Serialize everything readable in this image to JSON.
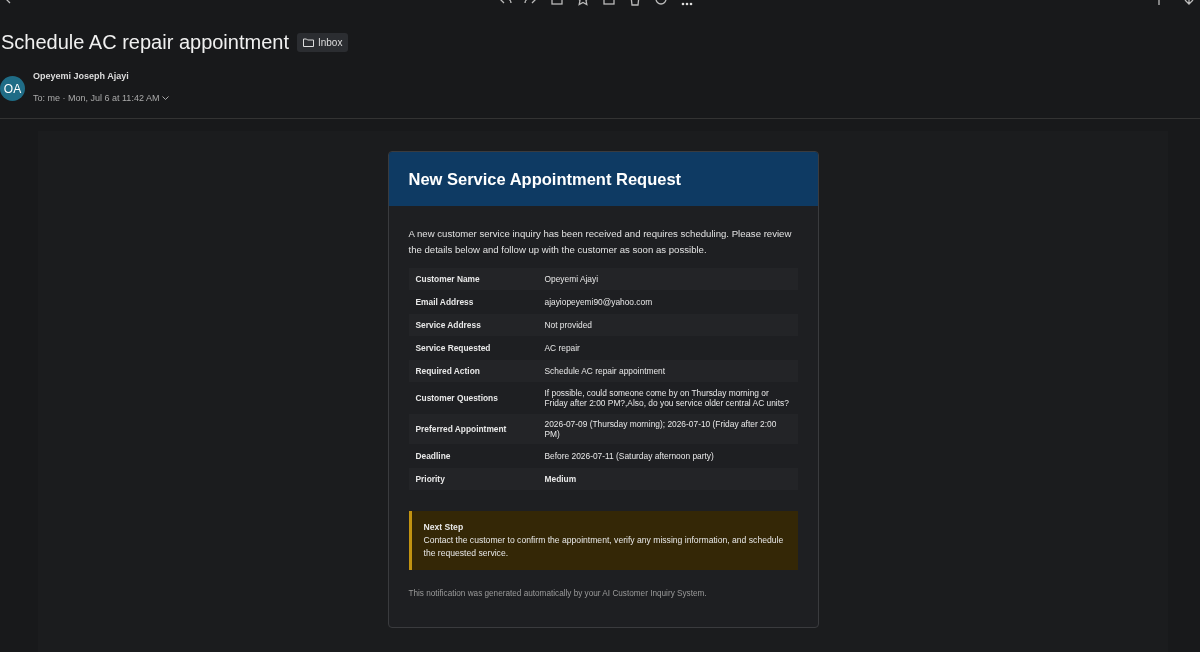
{
  "message": {
    "subject": "Schedule AC repair appointment",
    "folder": "Inbox",
    "sender": {
      "initials": "OA",
      "name": "Opeyemi Joseph Ajayi",
      "recipient_line": "To: me · Mon, Jul 6 at 11:42 AM"
    }
  },
  "card": {
    "heading": "New Service Appointment Request",
    "intro": "A new customer service inquiry has been received and requires scheduling. Please review the details below and follow up with the customer as soon as possible.",
    "rows": [
      {
        "label": "Customer Name",
        "value": "Opeyemi Ajayi",
        "emphasized": false
      },
      {
        "label": "Email Address",
        "value": "ajayiopeyemi90@yahoo.com",
        "emphasized": false
      },
      {
        "label": "Service Address",
        "value": "Not provided",
        "emphasized": false
      },
      {
        "label": "Service Requested",
        "value": "AC repair",
        "emphasized": false
      },
      {
        "label": "Required Action",
        "value": "Schedule AC repair appointment",
        "emphasized": false
      },
      {
        "label": "Customer Questions",
        "value": "If possible, could someone come by on Thursday morning or Friday after 2:00 PM?,Also, do you service older central AC units?",
        "emphasized": false
      },
      {
        "label": "Preferred Appointment",
        "value": "2026-07-09 (Thursday morning); 2026-07-10 (Friday after 2:00 PM)",
        "emphasized": false
      },
      {
        "label": "Deadline",
        "value": "Before 2026-07-11 (Saturday afternoon party)",
        "emphasized": false
      },
      {
        "label": "Priority",
        "value": "Medium",
        "emphasized": true
      }
    ],
    "next_step": {
      "title": "Next Step",
      "text": "Contact the customer to confirm the appointment, verify any missing information, and schedule the requested service."
    },
    "footer": "This notification was generated automatically by your AI Customer Inquiry System."
  }
}
